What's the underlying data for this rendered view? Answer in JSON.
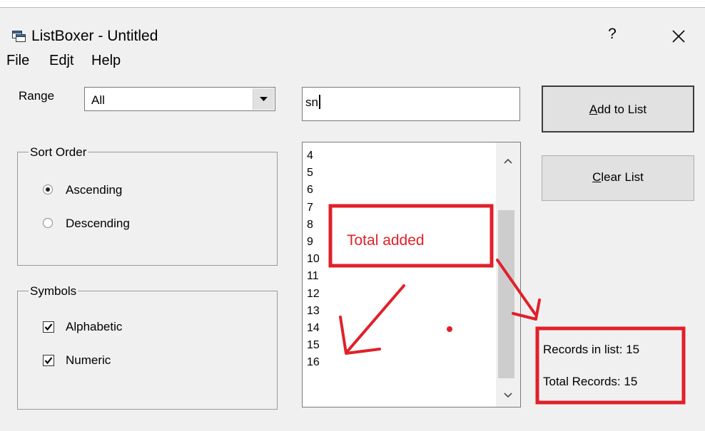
{
  "window": {
    "title": "ListBoxer - Untitled",
    "help": "?",
    "close": "×"
  },
  "menu": [
    "File",
    "Edjt",
    "Help"
  ],
  "range": {
    "label": "Range",
    "selected": "All"
  },
  "search": {
    "value": "sn"
  },
  "buttons": {
    "add_prefix": "A",
    "add_rest": "dd to List",
    "clear_prefix": "C",
    "clear_rest": "lear List"
  },
  "sort_order": {
    "title": "Sort Order",
    "options": [
      {
        "label": "Ascending",
        "selected": true
      },
      {
        "label": "Descending",
        "selected": false
      }
    ]
  },
  "symbols": {
    "title": "Symbols",
    "options": [
      {
        "label": "Alphabetic",
        "checked": true
      },
      {
        "label": "Numeric",
        "checked": true
      }
    ]
  },
  "list_items": [
    "4",
    "5",
    "6",
    "7",
    "8",
    "9",
    "10",
    "11",
    "12",
    "13",
    "14",
    "15",
    "16"
  ],
  "status": {
    "records_in_list": "Records in list: 15",
    "total_records": "Total Records: 15"
  },
  "annotation": {
    "text": "Total added",
    "color": "#e0202a"
  }
}
